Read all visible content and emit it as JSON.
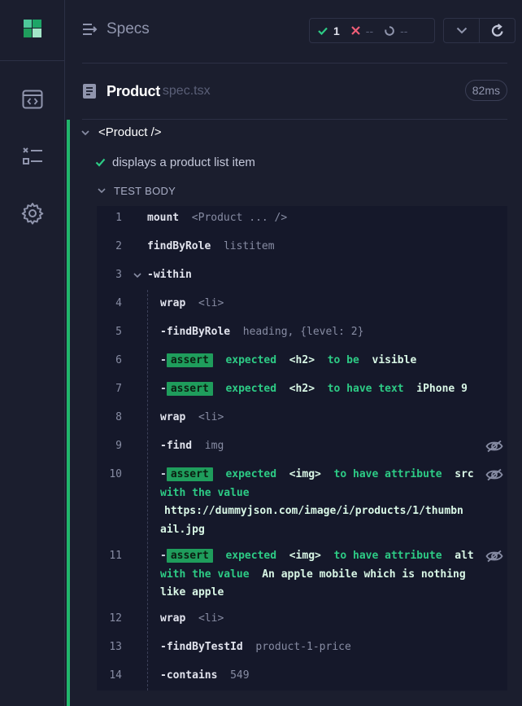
{
  "rail": {
    "logo_icon": "cypress-logo",
    "items": [
      "runs-icon",
      "specs-list-icon",
      "settings-icon"
    ]
  },
  "header": {
    "title": "Specs",
    "title_icon": "specs-arrow-icon"
  },
  "stats": {
    "passed": "1",
    "failed": "--",
    "pending": "--"
  },
  "file": {
    "name": "Product",
    "ext": "spec.tsx",
    "duration": "82ms"
  },
  "suite": {
    "label": "<Product />"
  },
  "test": {
    "label": "displays a product list item"
  },
  "test_body": {
    "label": "TEST BODY"
  },
  "commands": [
    {
      "num": "1",
      "name": "mount",
      "arg": "<Product ... />"
    },
    {
      "num": "2",
      "name": "findByRole",
      "arg": "listitem"
    },
    {
      "num": "3",
      "name": "-within"
    },
    {
      "num": "4",
      "name": "wrap",
      "arg": "<li>"
    },
    {
      "num": "5",
      "name": "-findByRole",
      "arg": "heading, {level: 2}"
    },
    {
      "num": "6",
      "badge": "assert",
      "words": [
        "expected",
        "<h2>",
        "to be",
        "visible"
      ]
    },
    {
      "num": "7",
      "badge": "assert",
      "words": [
        "expected",
        "<h2>",
        "to have text",
        "iPhone 9"
      ]
    },
    {
      "num": "8",
      "name": "wrap",
      "arg": "<li>"
    },
    {
      "num": "9",
      "name": "-find",
      "arg": "img"
    },
    {
      "num": "10",
      "badge": "assert",
      "line1": [
        "expected",
        "<img>",
        "to have attribute",
        "src"
      ],
      "line2": "with the value",
      "line3": "https://dummyjson.com/image/i/products/1/thumbn",
      "line4": "ail.jpg"
    },
    {
      "num": "11",
      "badge": "assert",
      "line1": [
        "expected",
        "<img>",
        "to have attribute",
        "alt"
      ],
      "line2a": "with the value",
      "line2b": "An apple mobile which is nothing",
      "line3": "like apple"
    },
    {
      "num": "12",
      "name": "wrap",
      "arg": "<li>"
    },
    {
      "num": "13",
      "name": "-findByTestId",
      "arg": "product-1-price"
    },
    {
      "num": "14",
      "name": "-contains",
      "arg": "549"
    }
  ],
  "colors": {
    "bg": "#1b1e2e",
    "accent_green": "#21b76c",
    "fail_red": "#f05d77",
    "log_bg": "#15182a"
  }
}
